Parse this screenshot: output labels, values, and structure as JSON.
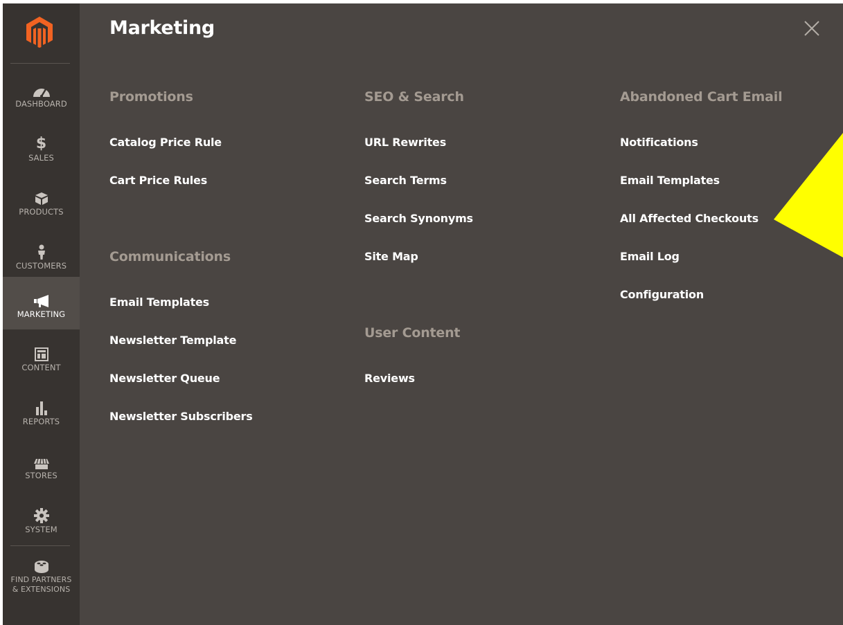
{
  "sidebar": {
    "items": [
      {
        "label": "DASHBOARD",
        "icon": "dashboard-icon"
      },
      {
        "label": "SALES",
        "icon": "dollar-icon"
      },
      {
        "label": "PRODUCTS",
        "icon": "cube-icon"
      },
      {
        "label": "CUSTOMERS",
        "icon": "person-icon"
      },
      {
        "label": "MARKETING",
        "icon": "megaphone-icon",
        "active": true
      },
      {
        "label": "CONTENT",
        "icon": "layout-icon"
      },
      {
        "label": "REPORTS",
        "icon": "bar-chart-icon"
      },
      {
        "label": "STORES",
        "icon": "storefront-icon"
      },
      {
        "label": "SYSTEM",
        "icon": "gear-icon"
      },
      {
        "label_line1": "FIND PARTNERS",
        "label_line2": "& EXTENSIONS",
        "icon": "lego-brick-icon"
      }
    ]
  },
  "panel": {
    "title": "Marketing",
    "sections": {
      "promotions": {
        "heading": "Promotions",
        "links": [
          "Catalog Price Rule",
          "Cart Price Rules"
        ]
      },
      "communications": {
        "heading": "Communications",
        "links": [
          "Email Templates",
          "Newsletter Template",
          "Newsletter Queue",
          "Newsletter Subscribers"
        ]
      },
      "seo_search": {
        "heading": "SEO & Search",
        "links": [
          "URL Rewrites",
          "Search Terms",
          "Search Synonyms",
          "Site Map"
        ]
      },
      "user_content": {
        "heading": "User Content",
        "links": [
          "Reviews"
        ]
      },
      "abandoned_cart": {
        "heading": "Abandoned Cart Email",
        "links": [
          "Notifications",
          "Email Templates",
          "All Affected Checkouts",
          "Email Log",
          "Configuration"
        ]
      }
    }
  },
  "colors": {
    "sidebar_bg": "#373330",
    "sidebar_active_bg": "#524d49",
    "panel_bg": "#4a4542",
    "heading_text": "#a49b92",
    "logo_orange": "#f26322",
    "annotation_arrow": "#ffff00"
  }
}
